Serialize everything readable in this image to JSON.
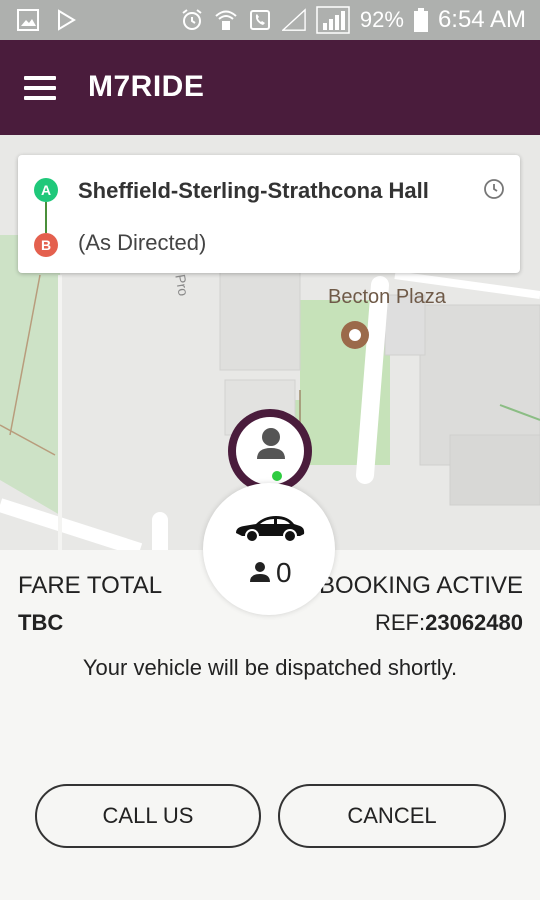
{
  "status_bar": {
    "battery": "92%",
    "time": "6:54 AM"
  },
  "app": {
    "title": "M7RIDE"
  },
  "route": {
    "from": "Sheffield-Sterling-Strathcona Hall",
    "to": "(As Directed)",
    "pin_a": "A",
    "pin_b": "B"
  },
  "map": {
    "poi_name": "Becton Plaza",
    "road_label": "Pro"
  },
  "vehicle": {
    "passenger_count": "0"
  },
  "booking": {
    "fare_label": "FARE TOTAL",
    "fare_value": "TBC",
    "status_label": "BOOKING ACTIVE",
    "ref_label": "REF:",
    "ref_number": "23062480",
    "message": "Your vehicle will be dispatched shortly."
  },
  "actions": {
    "call_label": "CALL US",
    "cancel_label": "CANCEL"
  },
  "colors": {
    "app_bar": "#4a1c3c",
    "pin_a": "#1fc87a",
    "pin_b": "#e4604e",
    "online_dot": "#2ecc40"
  }
}
